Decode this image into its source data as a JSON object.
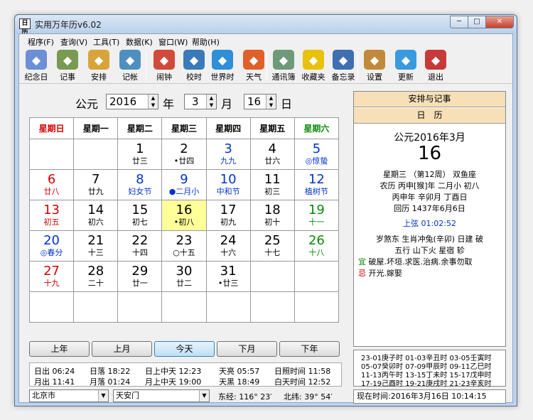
{
  "window": {
    "title": "实用万年历v6.02",
    "title_icon": "日历",
    "min": "─",
    "max": "□",
    "close": "✕"
  },
  "menu": [
    "程序(F)",
    "查询(V)",
    "工具(T)",
    "数据(K)",
    "窗口(W)",
    "帮助(H)"
  ],
  "tools": [
    {
      "label": "纪念日",
      "icon": "anniversary-icon",
      "color": "#6c8fd6"
    },
    {
      "label": "记事",
      "icon": "notes-icon",
      "color": "#7a9a52"
    },
    {
      "label": "安排",
      "icon": "schedule-icon",
      "color": "#d8a43a"
    },
    {
      "label": "记帐",
      "icon": "ledger-icon",
      "color": "#4f8fbf"
    },
    {
      "label": "闹钟",
      "icon": "alarm-clock-icon",
      "color": "#d14a3a"
    },
    {
      "label": "校时",
      "icon": "time-sync-icon",
      "color": "#3a7ab8"
    },
    {
      "label": "世界时",
      "icon": "globe-icon",
      "color": "#2f8fd8"
    },
    {
      "label": "天气",
      "icon": "weather-icon",
      "color": "#e0602a"
    },
    {
      "label": "通讯簿",
      "icon": "address-book-icon",
      "color": "#6f9a7a"
    },
    {
      "label": "收藏夹",
      "icon": "star-icon",
      "color": "#e8c20a"
    },
    {
      "label": "备忘录",
      "icon": "memo-icon",
      "color": "#3f6fb0"
    },
    {
      "label": "设置",
      "icon": "settings-icon",
      "color": "#c08a3a"
    },
    {
      "label": "更新",
      "icon": "update-icon",
      "color": "#3a9adf"
    },
    {
      "label": "退出",
      "icon": "exit-icon",
      "color": "#c83a3a"
    }
  ],
  "datebar": {
    "prefix": "公元",
    "year": "2016",
    "year_unit": "年",
    "month": "3",
    "month_unit": "月",
    "day": "16",
    "day_unit": "日"
  },
  "weekdays": [
    "星期日",
    "星期一",
    "星期二",
    "星期三",
    "星期四",
    "星期五",
    "星期六"
  ],
  "weeks": [
    [
      {
        "n": "",
        "s": ""
      },
      {
        "n": "",
        "s": ""
      },
      {
        "n": "1",
        "s": "廿三"
      },
      {
        "n": "2",
        "s": "•廿四"
      },
      {
        "n": "3",
        "s": "九九"
      },
      {
        "n": "4",
        "s": "廿六"
      },
      {
        "n": "5",
        "s": "◎惊蛰"
      }
    ],
    [
      {
        "n": "6",
        "s": "廿八"
      },
      {
        "n": "7",
        "s": "廿九"
      },
      {
        "n": "8",
        "s": "妇女节"
      },
      {
        "n": "9",
        "s": "●二月小"
      },
      {
        "n": "10",
        "s": "中和节"
      },
      {
        "n": "11",
        "s": "初三"
      },
      {
        "n": "12",
        "s": "植树节"
      }
    ],
    [
      {
        "n": "13",
        "s": "初五"
      },
      {
        "n": "14",
        "s": "初六"
      },
      {
        "n": "15",
        "s": "初七"
      },
      {
        "n": "16",
        "s": "•初八"
      },
      {
        "n": "17",
        "s": "初九"
      },
      {
        "n": "18",
        "s": "初十"
      },
      {
        "n": "19",
        "s": "十一"
      }
    ],
    [
      {
        "n": "20",
        "s": "◎春分"
      },
      {
        "n": "21",
        "s": "十三"
      },
      {
        "n": "22",
        "s": "十四"
      },
      {
        "n": "23",
        "s": "○十五"
      },
      {
        "n": "24",
        "s": "十六"
      },
      {
        "n": "25",
        "s": "十七"
      },
      {
        "n": "26",
        "s": "十八"
      }
    ],
    [
      {
        "n": "27",
        "s": "十九"
      },
      {
        "n": "28",
        "s": "二十"
      },
      {
        "n": "29",
        "s": "廿一"
      },
      {
        "n": "30",
        "s": "廿二"
      },
      {
        "n": "31",
        "s": "•廿三"
      },
      {
        "n": "",
        "s": ""
      },
      {
        "n": "",
        "s": ""
      }
    ],
    [
      {
        "n": "",
        "s": ""
      },
      {
        "n": "",
        "s": ""
      },
      {
        "n": "",
        "s": ""
      },
      {
        "n": "",
        "s": ""
      },
      {
        "n": "",
        "s": ""
      },
      {
        "n": "",
        "s": ""
      },
      {
        "n": "",
        "s": ""
      }
    ]
  ],
  "nav": [
    "上年",
    "上月",
    "今天",
    "下月",
    "下年"
  ],
  "info": {
    "r1": [
      "日出 06:24",
      "日落 18:22",
      "日上中天 12:23",
      "天亮 05:57",
      "日照时间 11:58"
    ],
    "r2": [
      "月出 11:41",
      "月落 01:24",
      "月上中天 19:00",
      "天黑 18:49",
      "白天时间 12:52"
    ]
  },
  "location": {
    "city": "北京市",
    "place": "天安门",
    "lon": "东经: 116° 23′",
    "lat": "北纬: 39° 54′"
  },
  "panel": {
    "head1": "安排与记事",
    "head2": "日　历",
    "ymd": "公元2016年3月",
    "day": "16",
    "l1": "星期三 （第12周） 双鱼座",
    "l2": "农历 丙申[猴]年 二月小 初八",
    "l3": "丙申年 辛卯月 丁酉日",
    "l4": "回历 1437年6月6日",
    "phase": "上弦 01:02:52",
    "l5": "岁煞东 生肖冲兔(辛卯) 日建 破",
    "l6": "五行 山下火 星宿 轸",
    "yi_tag": "宜",
    "yi": "破屋.坏垣.求医.治病.余事勿取",
    "ji_tag": "忌",
    "ji": "开光.嫁娶"
  },
  "hours": [
    "23-01庚子时 01-03辛丑时 03-05壬寅时",
    "05-07癸卯时 07-09甲辰时 09-11乙巳时",
    "11-13丙午时 13-15丁未时 15-17戊申时",
    "17-19己酉时 19-21庚戌时 21-23辛亥时"
  ],
  "now": "现在时间:2016年3月16日 10:14:15"
}
